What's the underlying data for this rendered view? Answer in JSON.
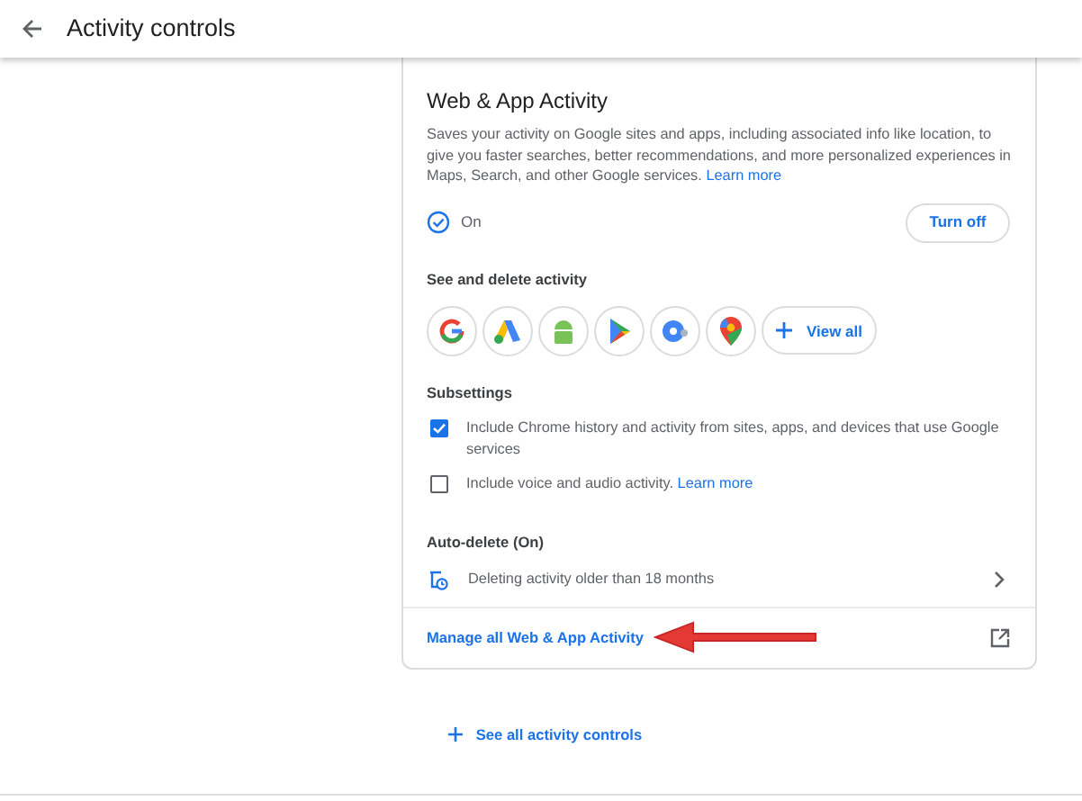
{
  "header": {
    "title": "Activity controls"
  },
  "card": {
    "title": "Web & App Activity",
    "description": "Saves your activity on Google sites and apps, including associated info like location, to give you faster searches, better recommendations, and more personalized experiences in Maps, Search, and other Google services.",
    "learn_more": "Learn more",
    "status": {
      "label": "On",
      "on": true
    },
    "turn_off": "Turn off",
    "see_delete": {
      "heading": "See and delete activity",
      "view_all": "View all"
    },
    "subsettings": {
      "heading": "Subsettings",
      "items": [
        {
          "label": "Include Chrome history and activity from sites, apps, and devices that use Google services",
          "checked": true
        },
        {
          "label": "Include voice and audio activity.",
          "link": "Learn more",
          "checked": false
        }
      ]
    },
    "auto_delete": {
      "heading": "Auto-delete (On)",
      "text": "Deleting activity older than 18 months"
    },
    "manage_link": "Manage all Web & App Activity"
  },
  "see_all": "See all activity controls"
}
